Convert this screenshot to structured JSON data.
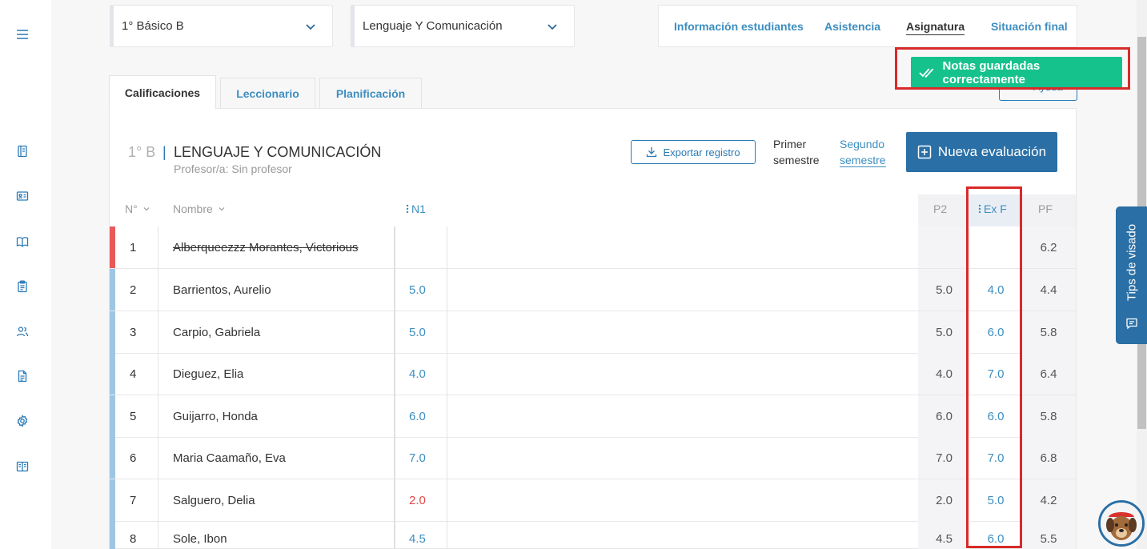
{
  "selectors": {
    "course": "1° Básico B",
    "subject": "Lenguaje Y Comunicación"
  },
  "topnav": {
    "items": [
      "Información estudiantes",
      "Asistencia",
      "Asignatura",
      "Situación final"
    ],
    "active": "Asignatura"
  },
  "toast": {
    "message": "Notas guardadas correctamente",
    "color": "#16c28b"
  },
  "help_button": {
    "label": "Ayuda"
  },
  "tabs": [
    "Calificaciones",
    "Leccionario",
    "Planificación"
  ],
  "course_header": {
    "code": "1° B",
    "separator": "|",
    "name": "LENGUAJE Y COMUNICACIÓN",
    "teacher": "Profesor/a: Sin profesor"
  },
  "actions": {
    "export_label": "Exportar registro",
    "semester1_line1": "Primer",
    "semester1_line2": "semestre",
    "semester2_line1": "Segundo",
    "semester2_line2": "semestre",
    "new_eval_label": "Nueva evaluación"
  },
  "table": {
    "headers": {
      "num": "N°",
      "name": "Nombre",
      "n1": "N1",
      "p2": "P2",
      "exf": "Ex F",
      "pf": "PF"
    },
    "rows": [
      {
        "num": "1",
        "name": "Alberqueezzz Morantes, Victorious",
        "n1": "",
        "p2": "",
        "exf": "",
        "pf": "6.2"
      },
      {
        "num": "2",
        "name": "Barrientos, Aurelio",
        "n1": "5.0",
        "p2": "5.0",
        "exf": "4.0",
        "pf": "4.4"
      },
      {
        "num": "3",
        "name": "Carpio, Gabriela",
        "n1": "5.0",
        "p2": "5.0",
        "exf": "6.0",
        "pf": "5.8"
      },
      {
        "num": "4",
        "name": "Dieguez, Elia",
        "n1": "4.0",
        "p2": "4.0",
        "exf": "7.0",
        "pf": "6.4"
      },
      {
        "num": "5",
        "name": "Guijarro, Honda",
        "n1": "6.0",
        "p2": "6.0",
        "exf": "6.0",
        "pf": "5.8"
      },
      {
        "num": "6",
        "name": "Maria Caamaño, Eva",
        "n1": "7.0",
        "p2": "7.0",
        "exf": "7.0",
        "pf": "6.8"
      },
      {
        "num": "7",
        "name": "Salguero, Delia",
        "n1": "2.0",
        "p2": "2.0",
        "exf": "5.0",
        "pf": "4.2"
      },
      {
        "num": "8",
        "name": "Sole, Ibon",
        "n1": "4.5",
        "p2": "4.5",
        "exf": "6.0",
        "pf": "5.5"
      }
    ]
  },
  "tips": {
    "label": "Tips de visado"
  },
  "colors": {
    "accent": "#2a6fa5",
    "link": "#3d8ec0",
    "highlight": "#d92a2a",
    "failing_grade": "#e04848"
  }
}
